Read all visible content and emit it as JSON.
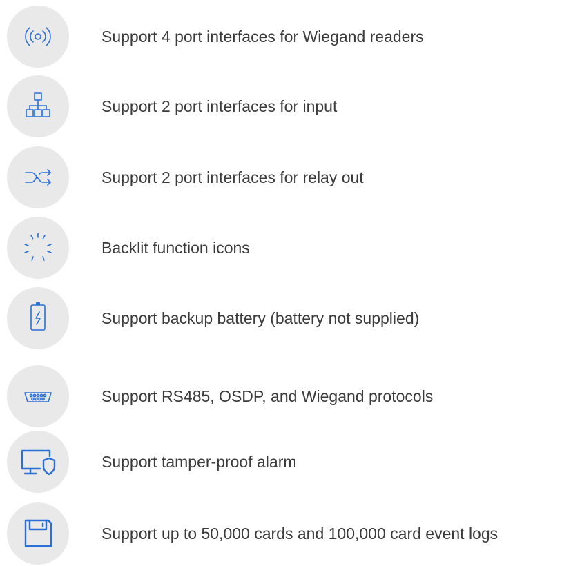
{
  "colors": {
    "accent": "#2b6fd6",
    "icon_bg": "#e9e9ea",
    "text": "#3a3a3a"
  },
  "features": [
    {
      "icon": "wireless-signal-icon",
      "text": "Support 4 port interfaces for Wiegand readers"
    },
    {
      "icon": "network-hierarchy-icon",
      "text": "Support 2 port interfaces for input"
    },
    {
      "icon": "shuffle-arrows-icon",
      "text": "Support 2 port interfaces for relay out"
    },
    {
      "icon": "backlight-rays-icon",
      "text": "Backlit function icons"
    },
    {
      "icon": "battery-charging-icon",
      "text": "Support backup battery (battery not supplied)"
    },
    {
      "icon": "serial-port-icon",
      "text": "Support RS485, OSDP, and Wiegand protocols"
    },
    {
      "icon": "monitor-shield-icon",
      "text": "Support tamper-proof alarm"
    },
    {
      "icon": "floppy-disk-icon",
      "text": "Support up to 50,000 cards and 100,000 card event logs"
    }
  ]
}
